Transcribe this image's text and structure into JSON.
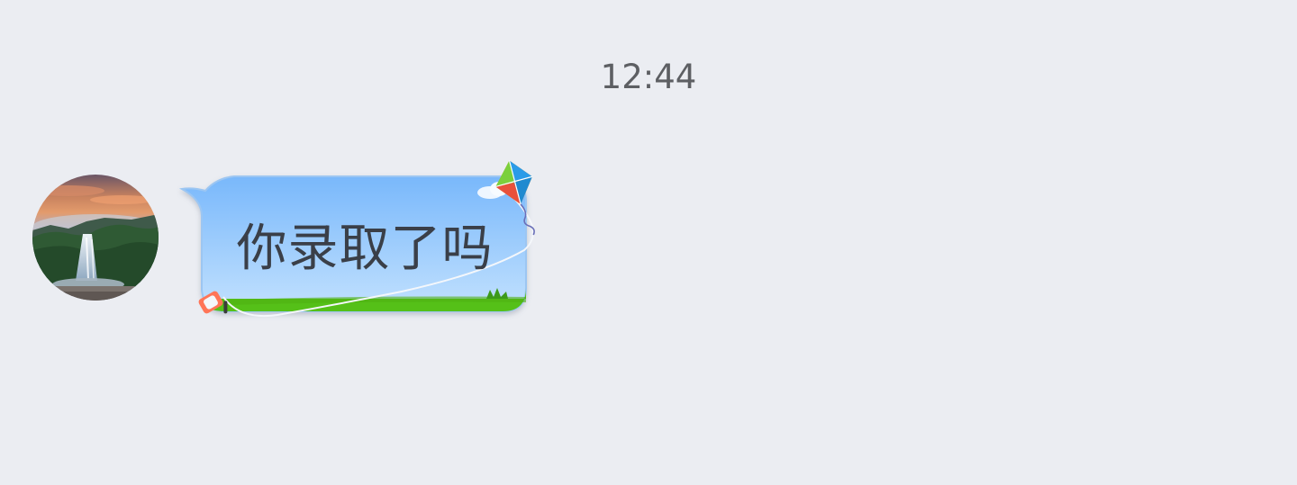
{
  "chat": {
    "timestamp": "12:44",
    "message": {
      "text": "你录取了吗",
      "sender_avatar": "landscape-waterfall-avatar",
      "bubble_theme": "kite-sky-grass",
      "bubble_colors": {
        "sky_top": "#7ab9fb",
        "sky_bottom": "#bfe0fe",
        "grass": "#55c018",
        "outline": "#9cc6f2"
      }
    }
  }
}
